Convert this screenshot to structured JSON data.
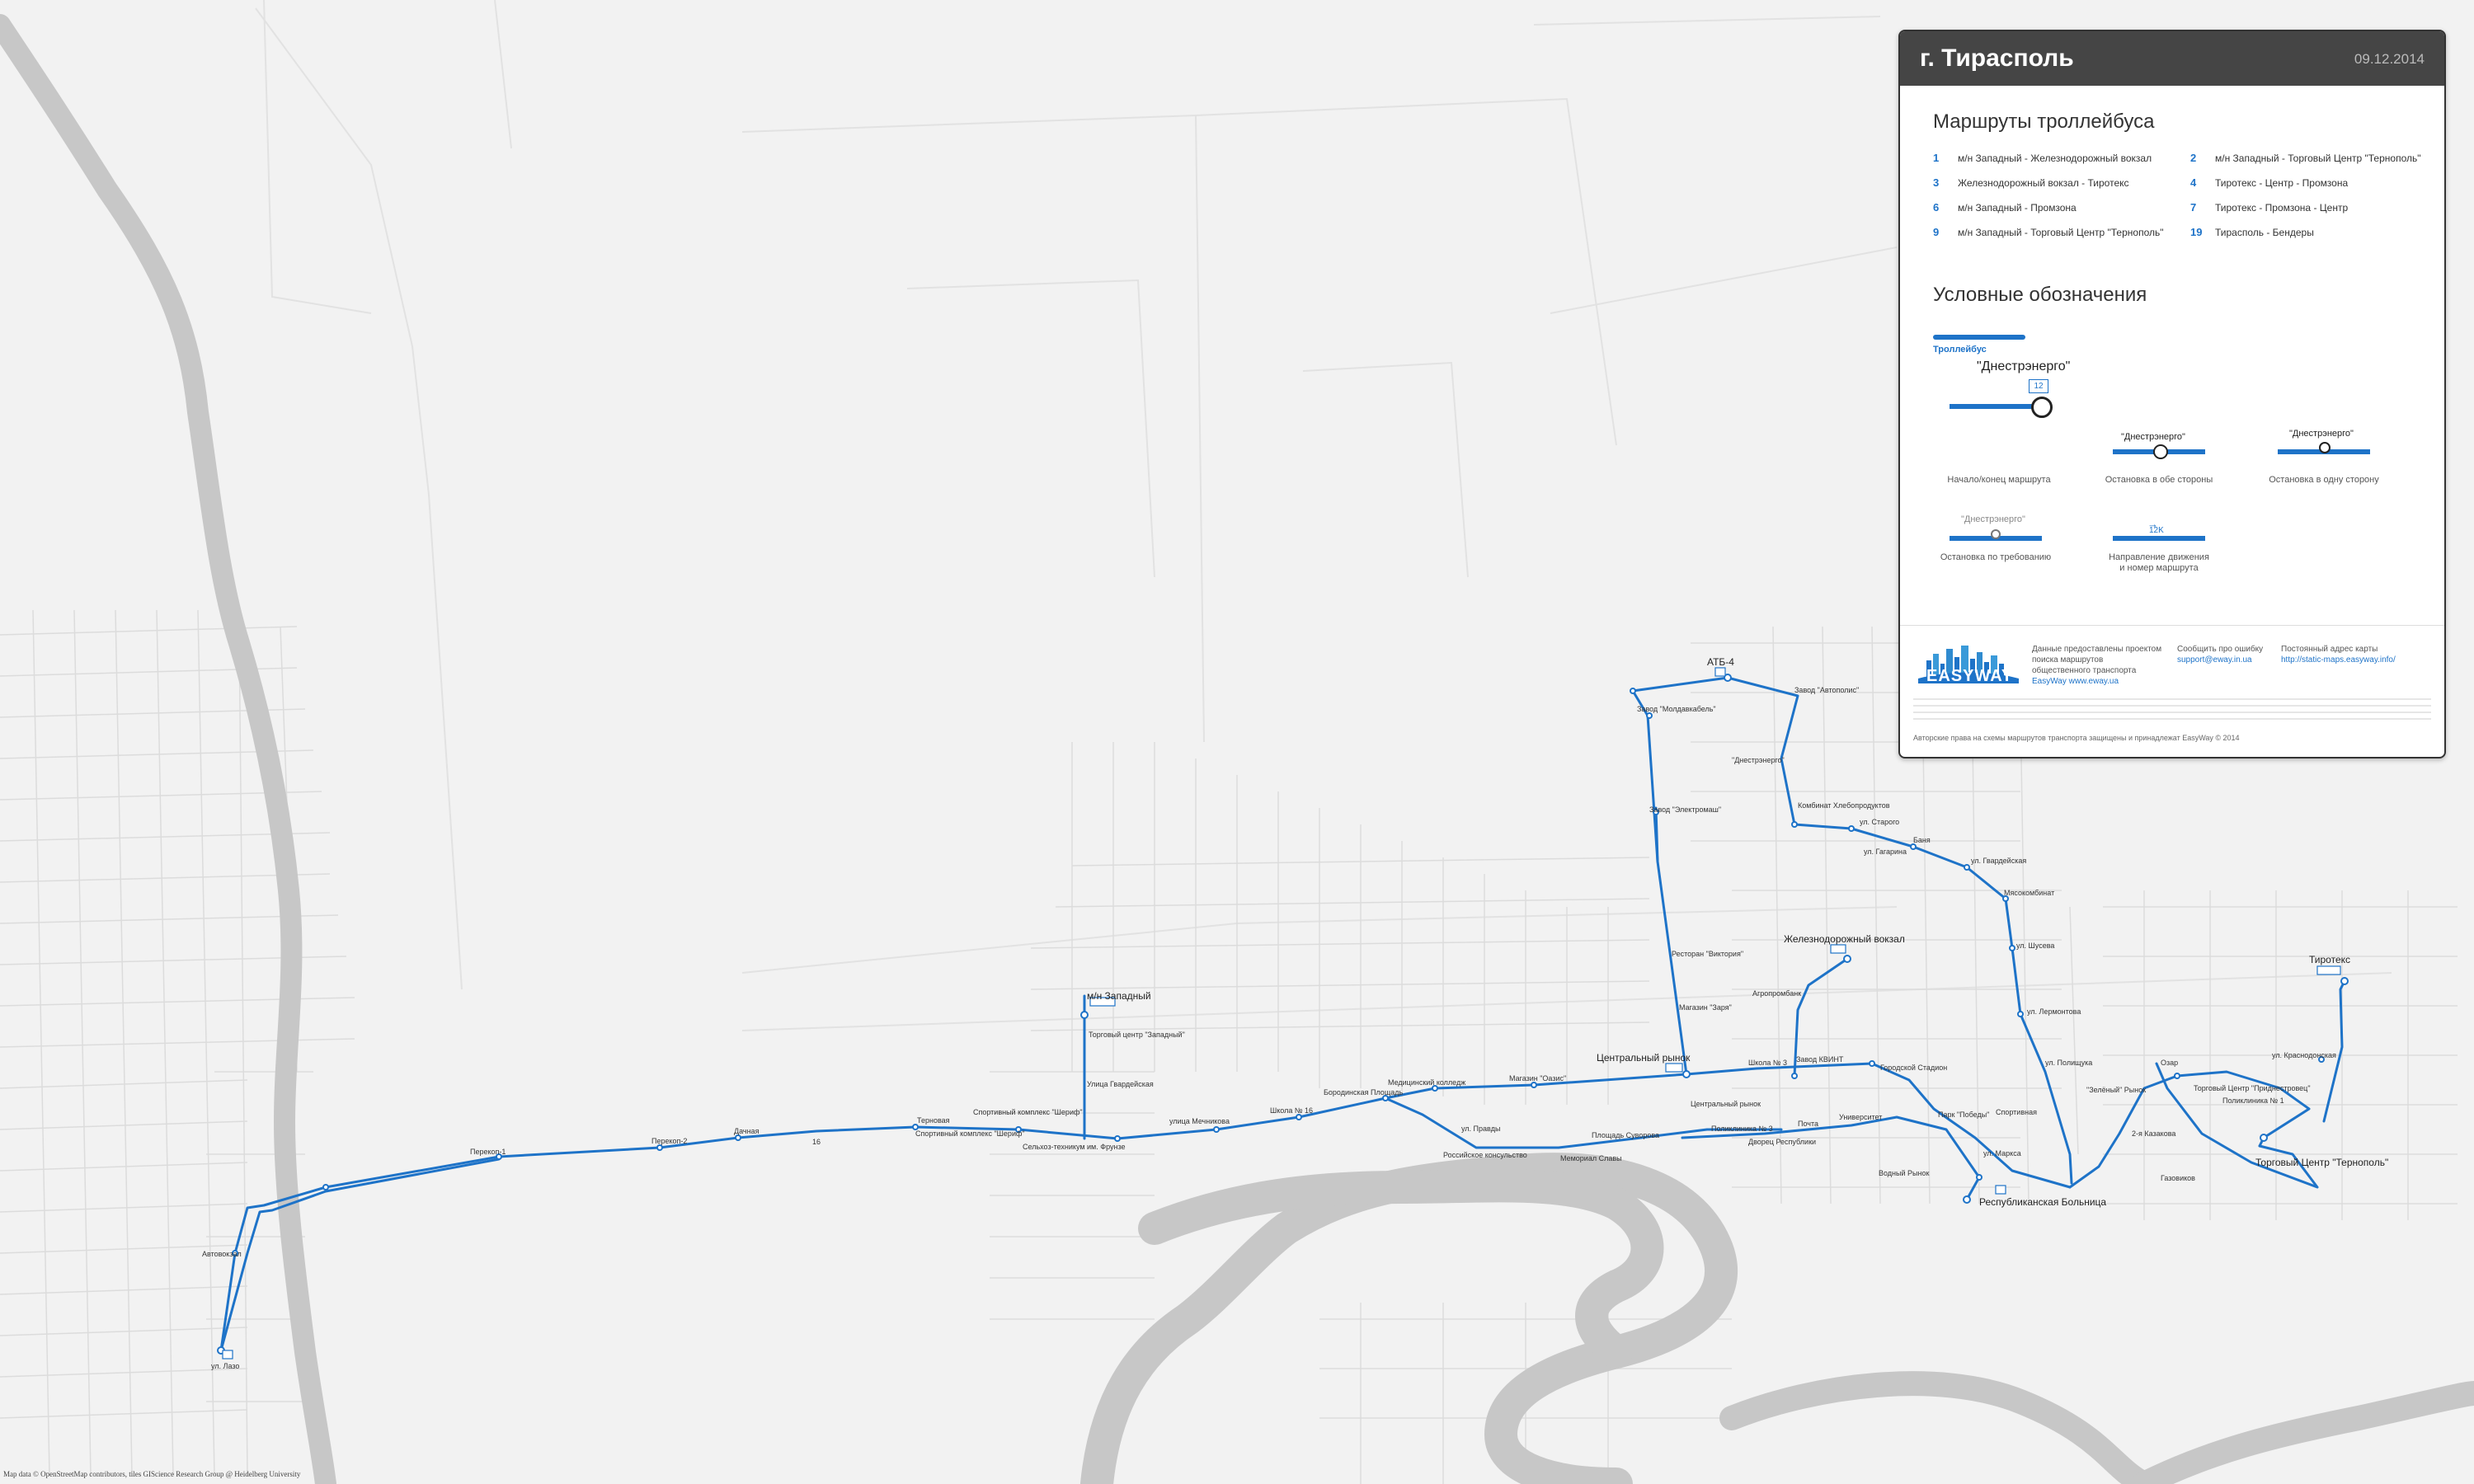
{
  "panel": {
    "title": "г. Тирасполь",
    "date": "09.12.2014",
    "routes_title": "Маршруты троллейбуса",
    "routes": [
      {
        "num": "1",
        "name": "м/н Западный - Железнодорожный вокзал"
      },
      {
        "num": "2",
        "name": "м/н Западный - Торговый Центр \"Тернополь\""
      },
      {
        "num": "3",
        "name": "Железнодорожный вокзал - Тиротекс"
      },
      {
        "num": "4",
        "name": "Тиротекс - Центр - Промзона"
      },
      {
        "num": "6",
        "name": "м/н Западный - Промзона"
      },
      {
        "num": "7",
        "name": "Тиротекс - Промзона - Центр"
      },
      {
        "num": "9",
        "name": "м/н Западный - Торговый Центр \"Тернополь\""
      },
      {
        "num": "19",
        "name": "Тирасполь - Бендеры"
      }
    ],
    "legend_title": "Условные обозначения",
    "legend_line_label": "Троллейбус",
    "legend": {
      "sample_stop": "\"Днестрэнерго\"",
      "sample_num": "12",
      "sample_dir": "12K",
      "terminal": "Начало/конец маршрута",
      "both_ways": "Остановка в обе стороны",
      "one_way": "Остановка в одну сторону",
      "on_request": "Остановка по требованию",
      "direction_line1": "Направление движения",
      "direction_line2": "и номер маршрута"
    },
    "footer": {
      "logo": "EASYWAY",
      "data_text_1": "Данные предоставлены проектом",
      "data_text_2": "поиска маршрутов",
      "data_text_3": "общественного транспорта",
      "data_text_4": "EasyWay www.eway.ua",
      "report_label": "Сообщить про ошибку",
      "report_email": "support@eway.in.ua",
      "perm_label": "Постоянный адрес карты",
      "perm_url": "http://static-maps.easyway.info/",
      "copyright": "Авторские права на схемы маршрутов транспорта защищены и принадлежат EasyWay © 2014"
    }
  },
  "attribution": "Map data © OpenStreetMap contributors, tiles GIScience Research Group @ Heidelberg University",
  "stops": {
    "lazo": "ул. Лазо",
    "avtovokzal": "Автовокзал",
    "perekop1": "Перекоп-1",
    "perekop2": "Перекоп-2",
    "dachnaya": "Дачная",
    "terminal_west": "м/н Западный",
    "zapadny_tc": "Торговый центр \"Западный\"",
    "ul_gvardeiskaya": "Улица Гвардейская",
    "termovaya": "Терновая",
    "sport_1": "Спортивный комплекс \"Шериф\"",
    "sport_2": "Спортивный комплекс \"Шериф\"",
    "tekhnikum": "Сельхоз-техникум им. Фрунзе",
    "mechnikova": "улица Мечникова",
    "school16": "Школа № 16",
    "borodin": "Бородинская Площадь",
    "med": "Медицинский колледж",
    "oazis": "Магазин \"Оазис\"",
    "central_market": "Центральный рынок",
    "school3": "Школа № 3",
    "zavod_kvint": "Завод КВИНТ",
    "gorodskoy_stadion": "Городской Стадион",
    "pobedy": "Парк \"Победы\"",
    "universitet": "Университет",
    "pochta": "Почта",
    "dvorec": "Дворец Республики",
    "policlinic": "Поликлиника № 3",
    "central_market_2": "Центральный рынок",
    "ploshad": "Площадь Суворова",
    "memorial": "Мемориал Славы",
    "rossiyskoe": "Российское консульство",
    "ul_pravdy": "ул. Правды",
    "sportivnaya": "Спортивная",
    "rep_hospital": "Республиканская Больница",
    "marx": "ул. Маркса",
    "vodnoy": "Водный Рынок",
    "ternopol": "Торговый Центр \"Тернополь\"",
    "tirotex": "Тиротекс",
    "rail_station": "Железнодорожный вокзал",
    "agro": "Агропромбанк",
    "magazin_zarya": "Магазин \"Заря\"",
    "victoria": "Ресторан \"Виктория\"",
    "elektromash": "Завод \"Электромаш\"",
    "dnestrenergo": "\"Днестрэнерго\"",
    "moldavkabel": "Завод \"Молдавкабель\"",
    "atb4": "АТБ-4",
    "avtopolis": "Завод \"Автополис\"",
    "hleboprod": "Комбинат Хлебопродуктов",
    "ul_starostina": "ул. Старого",
    "ul_gagarina": "ул. Гагарина",
    "banya": "Баня",
    "ul_gvardeyskaya2": "ул. Гвардейская",
    "myasokombinat": "Мясокомбинат",
    "ul_shusev": "ул. Шусева",
    "ul_lermontova": "ул. Лермонтова",
    "ul_poleshkina": "ул. Полищука",
    "zel_rynok": "\"Зелёный\" Рынок",
    "ozar": "Озар",
    "ul_krasnodonskaya": "ул. Краснодонская",
    "tc_pridnestr": "Торговый Центр \"Приднестровец\"",
    "poliklinika1": "Поликлиника № 1",
    "kazakov": "2-я Казакова",
    "gazoviki": "Газовиков",
    "dock": "16"
  },
  "colors": {
    "route": "#1e73c8",
    "river": "#c7c7c7",
    "background": "#f2f2f2",
    "header": "#454545"
  }
}
